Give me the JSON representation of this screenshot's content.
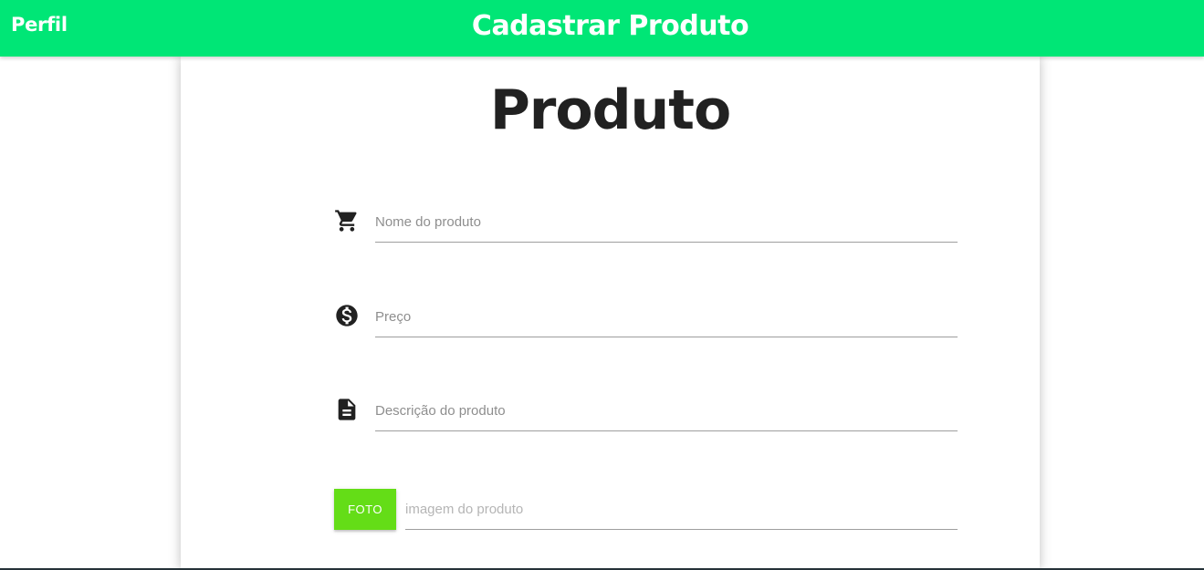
{
  "navbar": {
    "brand": "Perfil",
    "title": "Cadastrar Produto",
    "background": "#00e676"
  },
  "form": {
    "heading": "Produto",
    "fields": [
      {
        "icon": "shopping-cart-icon",
        "placeholder": "Nome do produto",
        "value": ""
      },
      {
        "icon": "monetization-icon",
        "placeholder": "Preço",
        "value": ""
      },
      {
        "icon": "description-icon",
        "placeholder": "Descrição do produto",
        "value": ""
      }
    ],
    "file": {
      "button_label": "FOTO",
      "placeholder": "imagem do produto",
      "button_color": "#64dd17"
    }
  }
}
